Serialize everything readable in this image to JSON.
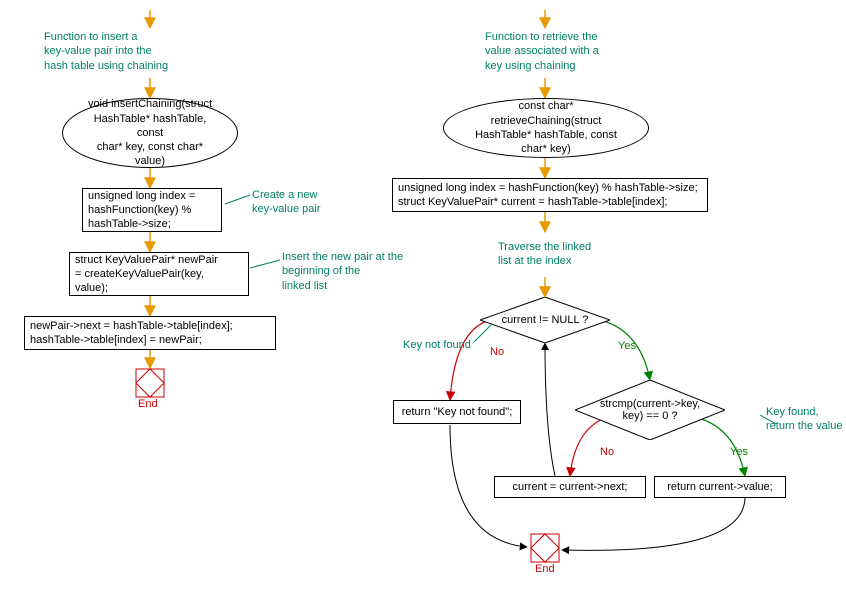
{
  "left": {
    "comment_insert": "Function to insert a\nkey-value pair into the\nhash table using chaining",
    "func_sig": "void insertChaining(struct\nHashTable* hashTable, const\nchar* key, const char*\nvalue)",
    "step1": "unsigned long index =\nhashFunction(key) %\nhashTable->size;",
    "comment_step1": "Create a new\nkey-value pair",
    "step2": "struct KeyValuePair* newPair\n= createKeyValuePair(key,\nvalue);",
    "comment_step2": "Insert the new pair at the\nbeginning of the\nlinked list",
    "step3": "newPair->next = hashTable->table[index];\nhashTable->table[index] = newPair;",
    "end_label": "End"
  },
  "right": {
    "comment_retrieve": "Function to retrieve the\nvalue associated with a\nkey using chaining",
    "func_sig": "const char* retrieveChaining(struct\nHashTable* hashTable, const\nchar* key)",
    "step1": "unsigned long index = hashFunction(key) % hashTable->size;\nstruct KeyValuePair* current = hashTable->table[index];",
    "comment_traverse": "Traverse the linked\nlist at the index",
    "dec1": "current != NULL ?",
    "dec1_yes": "Yes",
    "dec1_no": "No",
    "comment_keynotfound": "Key not found",
    "ret_notfound": "return \"Key not found\";",
    "dec2": "strcmp(current->key,\nkey) == 0 ?",
    "dec2_yes": "Yes",
    "dec2_no": "No",
    "comment_keyfound": "Key found,\nreturn the value",
    "advance": "current = current->next;",
    "ret_value": "return current->value;",
    "end_label": "End"
  }
}
